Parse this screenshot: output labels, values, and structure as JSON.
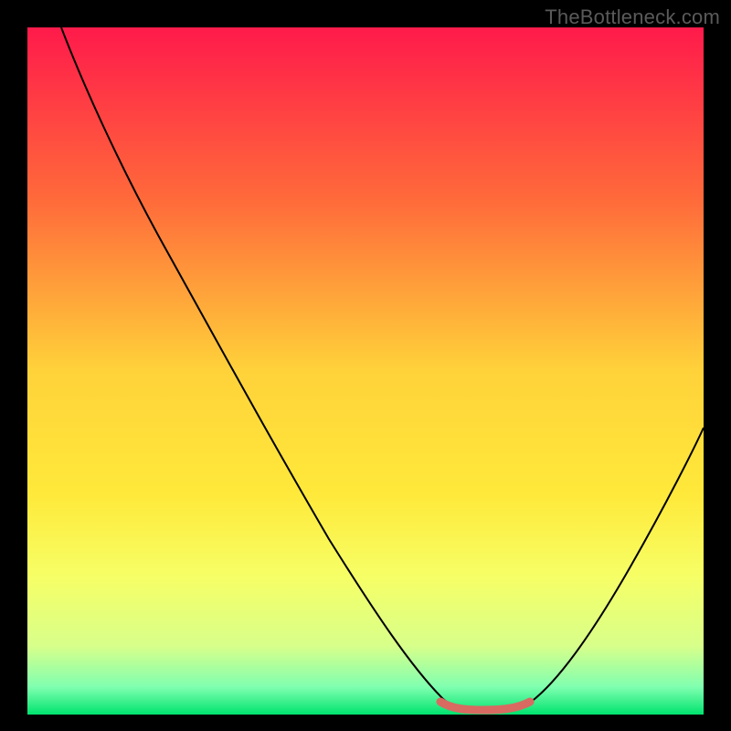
{
  "watermark": "TheBottleneck.com",
  "chart_data": {
    "type": "line",
    "title": "",
    "xlabel": "",
    "ylabel": "",
    "xlim": [
      0,
      100
    ],
    "ylim": [
      0,
      100
    ],
    "background_gradient": {
      "stops": [
        {
          "offset": 0,
          "color": "#ff1a4b"
        },
        {
          "offset": 25,
          "color": "#ff6a3a"
        },
        {
          "offset": 50,
          "color": "#ffd23a"
        },
        {
          "offset": 68,
          "color": "#ffe93a"
        },
        {
          "offset": 80,
          "color": "#f6ff66"
        },
        {
          "offset": 90,
          "color": "#d8ff8a"
        },
        {
          "offset": 96,
          "color": "#7fffb0"
        },
        {
          "offset": 100,
          "color": "#00e36e"
        }
      ]
    },
    "series": [
      {
        "name": "bottleneck-curve",
        "type": "line",
        "color": "#000000",
        "width": 2,
        "points": [
          {
            "x": 5,
            "y": 100
          },
          {
            "x": 10,
            "y": 92
          },
          {
            "x": 20,
            "y": 75
          },
          {
            "x": 30,
            "y": 58
          },
          {
            "x": 40,
            "y": 40
          },
          {
            "x": 50,
            "y": 22
          },
          {
            "x": 57,
            "y": 8
          },
          {
            "x": 61,
            "y": 2
          },
          {
            "x": 65,
            "y": 0.5
          },
          {
            "x": 72,
            "y": 0.5
          },
          {
            "x": 76,
            "y": 2
          },
          {
            "x": 82,
            "y": 10
          },
          {
            "x": 90,
            "y": 25
          },
          {
            "x": 100,
            "y": 45
          }
        ]
      },
      {
        "name": "optimal-range",
        "type": "marker-band",
        "color": "#d86a62",
        "width": 8,
        "points": [
          {
            "x": 61,
            "y": 1.5
          },
          {
            "x": 65,
            "y": 0.8
          },
          {
            "x": 70,
            "y": 0.8
          },
          {
            "x": 74,
            "y": 1.5
          }
        ]
      }
    ]
  }
}
